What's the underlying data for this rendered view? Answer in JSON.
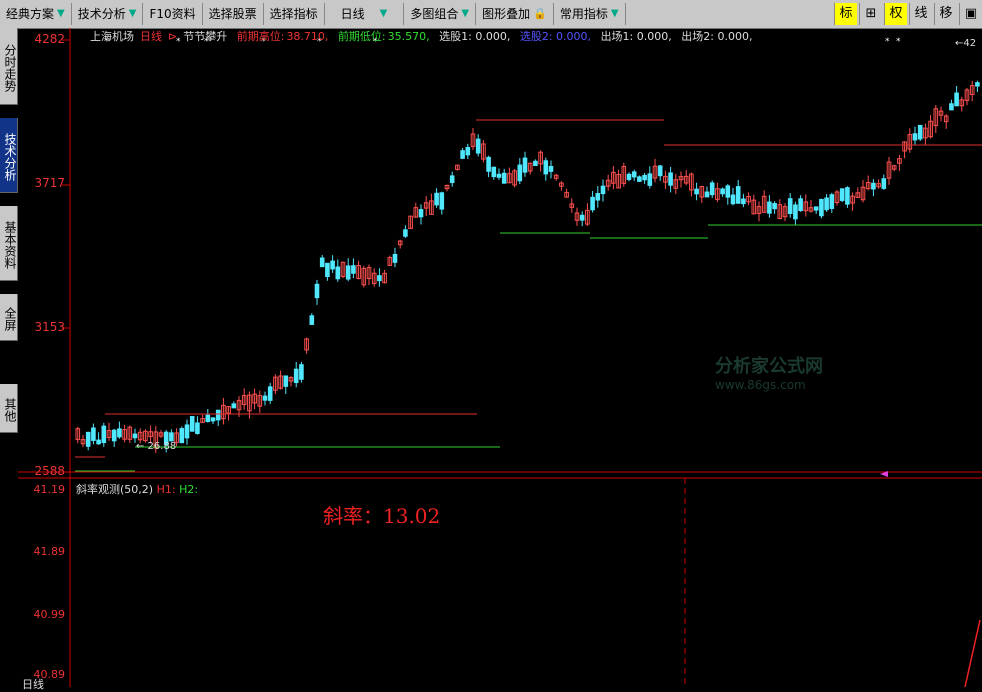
{
  "toolbar": {
    "items": [
      "经典方案",
      "技术分析",
      "F10资料",
      "选择股票",
      "选择指标",
      "日线",
      "多图组合",
      "图形叠加",
      "常用指标"
    ],
    "right_buttons": [
      "标",
      "⊞",
      "权",
      "线",
      "移",
      "▣"
    ]
  },
  "sidebar_tabs": [
    "分时走势",
    "技术分析",
    "基本资料",
    "全屏",
    "其他"
  ],
  "header": {
    "stock_name": "上海机场",
    "period": "日线",
    "indicator_name": "节节攀升",
    "prev_high_label": "前期高位:",
    "prev_high": "38.710,",
    "prev_low_label": "前期低位:",
    "prev_low": "35.570,",
    "select1": "选股1: 0.000,",
    "select2": "选股2: 0.000,",
    "exit1": "出场1: 0.000,",
    "exit2": "出场2: 0.000,"
  },
  "price_axis": [
    "4282",
    "3717",
    "3153",
    "2588"
  ],
  "price_labels": {
    "low_marker": "← 26.88",
    "high_marker": "←42"
  },
  "indicator": {
    "title": "斜率观测(50,2)",
    "h1": "H1:",
    "h2": "H2:",
    "axis": [
      "41.19",
      "41.89",
      "40.99",
      "40.89"
    ],
    "slope_text": "斜率：13.02"
  },
  "watermark": {
    "line1": "分析家公式网",
    "line2": "www.86gs.com"
  },
  "bottom": {
    "label": "日线"
  },
  "colors": {
    "up": "#ff5050",
    "down": "#50e8ff",
    "support": "#30d030",
    "resistance": "#e03030"
  }
}
